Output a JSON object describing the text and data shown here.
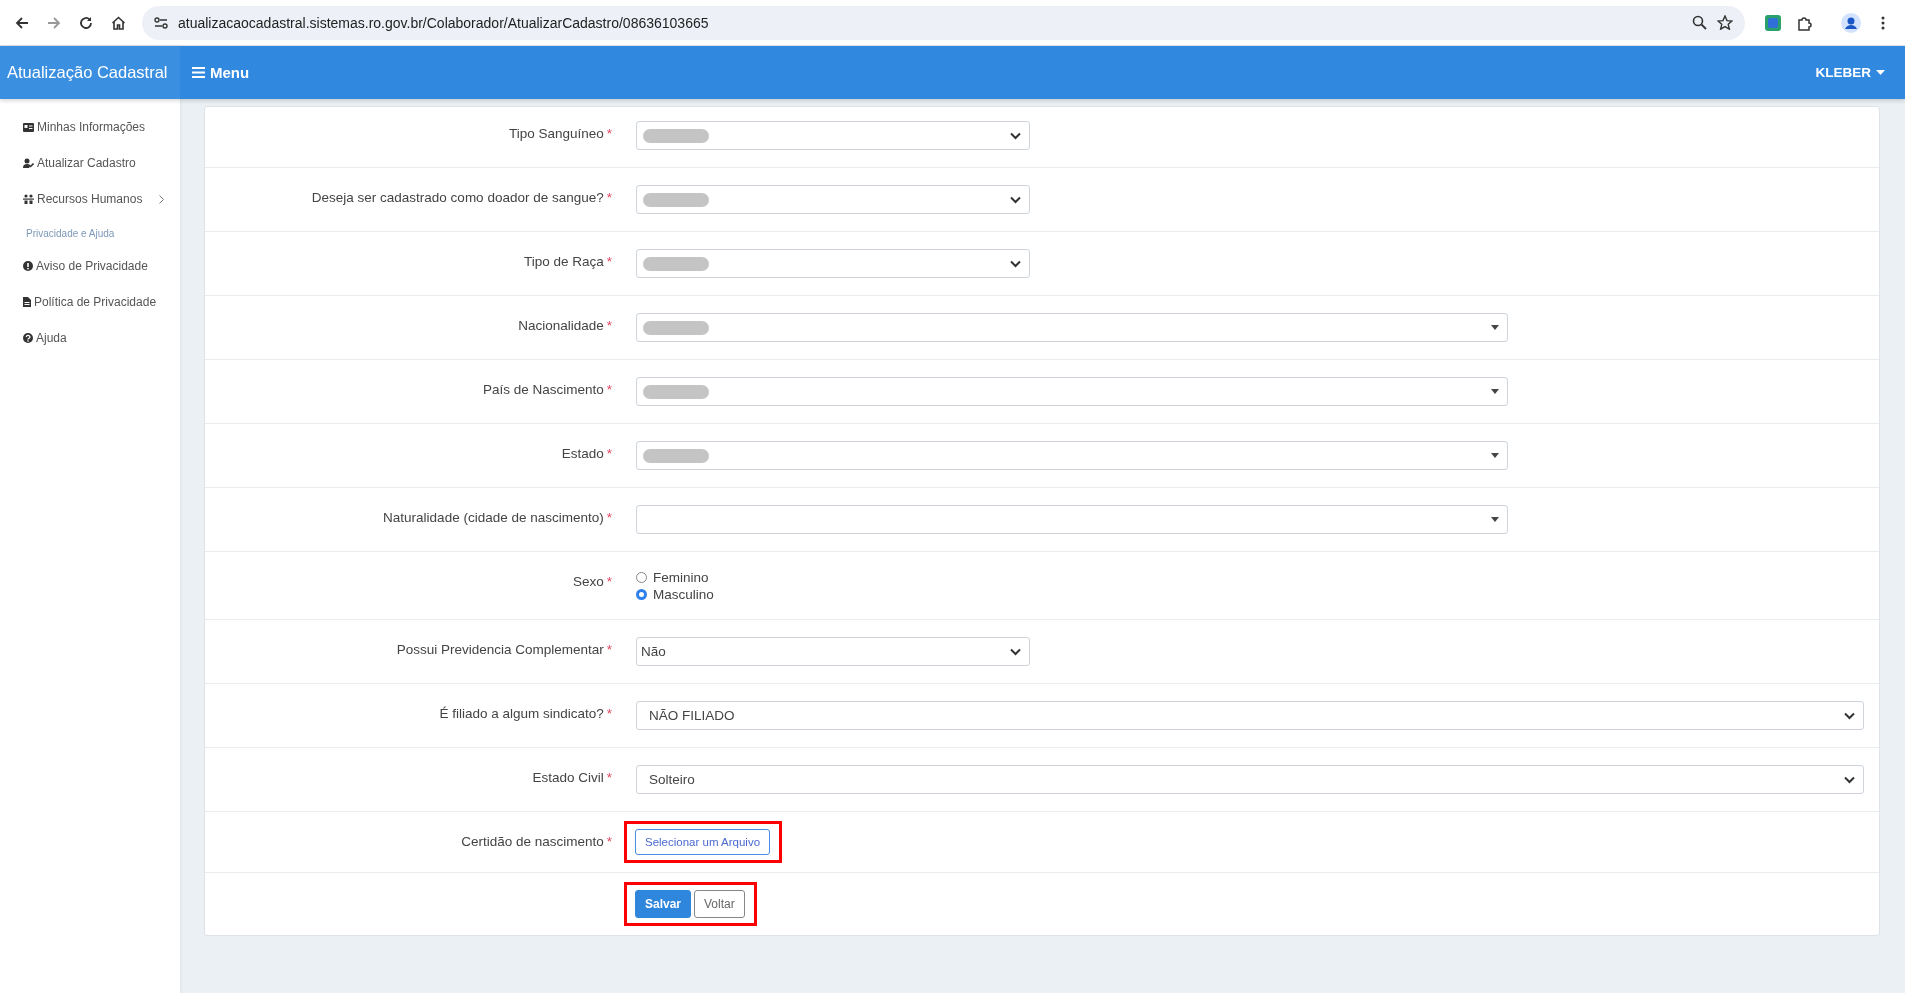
{
  "browser": {
    "url": "atualizacaocadastral.sistemas.ro.gov.br/Colaborador/AtualizarCadastro/08636103665"
  },
  "header": {
    "brand": "Atualização Cadastral",
    "menu_label": "Menu",
    "user": "KLEBER"
  },
  "sidebar": {
    "items": [
      {
        "label": "Minhas Informações",
        "kind": "link"
      },
      {
        "label": "Atualizar Cadastro",
        "kind": "link"
      },
      {
        "label": "Recursos Humanos",
        "kind": "submenu"
      }
    ],
    "section_title": "Privacidade e Ajuda",
    "help_items": [
      {
        "label": "Aviso de Privacidade"
      },
      {
        "label": "Política de Privacidade"
      },
      {
        "label": "Ajuda"
      }
    ]
  },
  "form": {
    "rows": [
      {
        "label": "Tipo Sanguíneo",
        "required_mark": "*",
        "kind": "select",
        "redacted": true
      },
      {
        "label": "Deseja ser cadastrado como doador de sangue?",
        "required_mark": "*",
        "kind": "select",
        "redacted": true
      },
      {
        "label": "Tipo de Raça",
        "required_mark": "*",
        "kind": "select",
        "redacted": true
      },
      {
        "label": "Nacionalidade",
        "required_mark": "*",
        "kind": "combo",
        "redacted": true
      },
      {
        "label": "País de Nascimento",
        "required_mark": "*",
        "kind": "combo",
        "redacted": true
      },
      {
        "label": "Estado",
        "required_mark": "*",
        "kind": "combo",
        "redacted": true
      },
      {
        "label": "Naturalidade (cidade de nascimento)",
        "required_mark": "*",
        "kind": "combo",
        "redacted": false
      },
      {
        "label": "Sexo",
        "required_mark": "*",
        "kind": "radio",
        "options": [
          {
            "label": "Feminino",
            "selected": false
          },
          {
            "label": "Masculino",
            "selected": true
          }
        ]
      },
      {
        "label": "Possui Previdencia Complementar",
        "required_mark": "*",
        "kind": "select",
        "value": "Não"
      },
      {
        "label": "É filiado a algum sindicato?",
        "required_mark": "*",
        "kind": "wide",
        "value": "NÃO FILIADO"
      },
      {
        "label": "Estado Civil",
        "required_mark": "*",
        "kind": "wide",
        "value": "Solteiro"
      },
      {
        "label": "Certidão de nascimento",
        "required_mark": "*",
        "kind": "file",
        "button_label": "Selecionar um Arquivo",
        "highlighted": true
      }
    ],
    "actions": {
      "highlighted": true,
      "buttons": [
        {
          "label": "Salvar",
          "kind": "primary"
        },
        {
          "label": "Voltar",
          "kind": "secondary"
        }
      ]
    }
  }
}
